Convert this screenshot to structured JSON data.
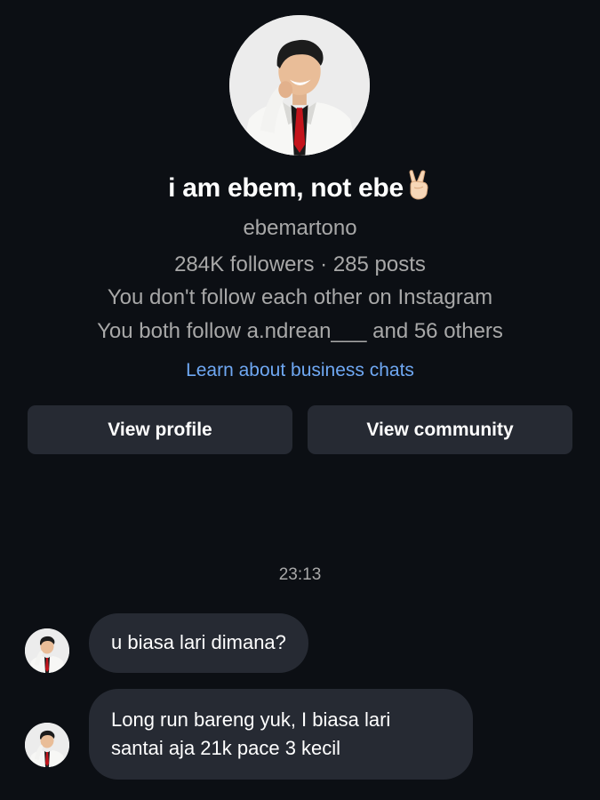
{
  "profile": {
    "display_name": "i am ebem, not ebe",
    "name_emoji": "victory-hand-emoji",
    "username": "ebemartono",
    "stats": "284K followers · 285 posts",
    "follow_status": "You don't follow each other on Instagram",
    "mutual": "You both follow a.ndrean___ and 56 others",
    "learn_link": "Learn about business chats"
  },
  "actions": {
    "view_profile": "View profile",
    "view_community": "View community"
  },
  "thread": {
    "timestamp": "23:13",
    "messages": [
      {
        "lines": [
          "u biasa lari dimana?"
        ]
      },
      {
        "lines": [
          "Long run bareng yuk, I biasa lari",
          "santai aja 21k pace 3 kecil"
        ]
      }
    ]
  },
  "colors": {
    "background": "#0c0f14",
    "button": "#262a33",
    "link": "#6fa8f3",
    "secondary_text": "#a8a8a8"
  }
}
